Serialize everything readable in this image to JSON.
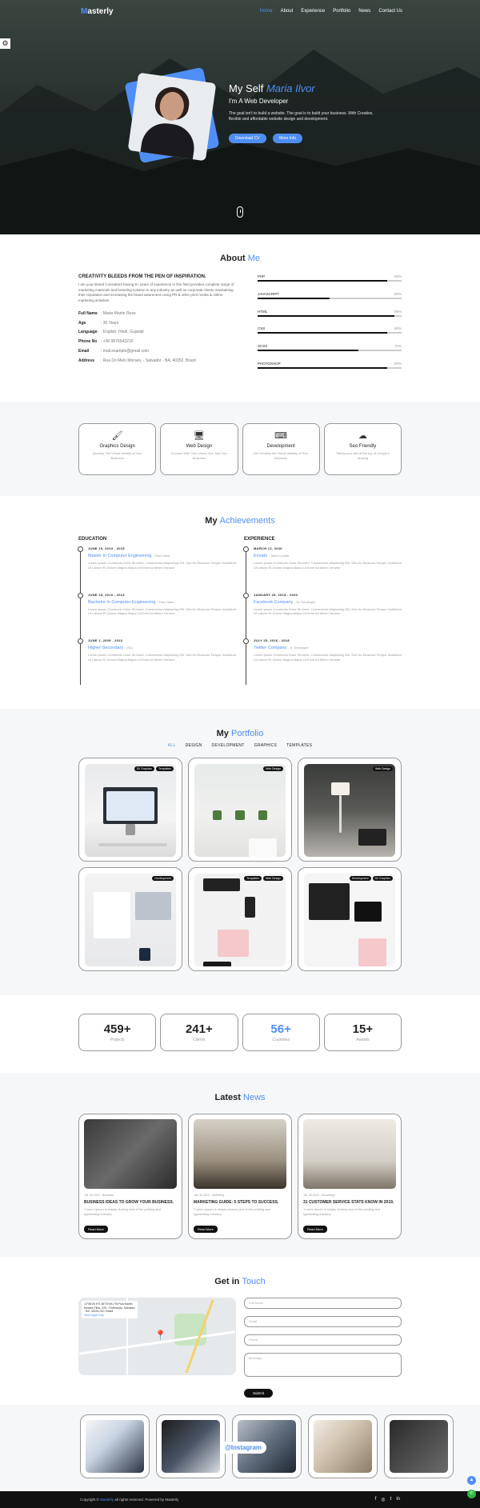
{
  "nav": {
    "logo_m": "M",
    "logo_rest": "asterly",
    "items": [
      "Home",
      "About",
      "Experience",
      "Portfolio",
      "News",
      "Contact Us"
    ]
  },
  "hero": {
    "title_prefix": "My Self",
    "title_name": "Maria Ilvor",
    "subtitle": "I'm A Web Developer",
    "desc": "The goal isn't to build a website. The goal is to build your business. With Creative, flexible and affordable website design and development.",
    "btn_cv": "Download CV",
    "btn_more": "More Info"
  },
  "about": {
    "title": "About",
    "title_accent": "Me",
    "heading": "CREATIVITY BLEEDS FROM THE PEN OF INSPIRATION.",
    "desc": "I am your Brand Consultant having 8+ years of experience in this field provides complete range of marketing materials and branding solution to any industry as well as corporate clients maintaining their reputation and increasing the brand awareness using PR & other print media & online marketing activities.",
    "info": [
      {
        "k": "Full Name",
        "v": ": Maria Martin Rose"
      },
      {
        "k": "Age",
        "v": ": 30 Years"
      },
      {
        "k": "Language",
        "v": ": English, Hindi, Gujarati"
      },
      {
        "k": "Phone No",
        "v": ": +00 9876543210"
      },
      {
        "k": "Email",
        "v": ": mail.example@gmail.com"
      },
      {
        "k": "Address",
        "v": ": Rua Do Melo Moraes, - Salvador - BA, 40352, Brazil"
      }
    ],
    "skills": [
      {
        "name": "PHP",
        "pct": "90%",
        "value": 0.9
      },
      {
        "name": "JAVASCRIPT",
        "pct": "50%",
        "value": 0.5
      },
      {
        "name": "HTML",
        "pct": "95%",
        "value": 0.95
      },
      {
        "name": "CSS",
        "pct": "90%",
        "value": 0.9
      },
      {
        "name": "SCSS",
        "pct": "70%",
        "value": 0.7
      },
      {
        "name": "PHOTOSHOP",
        "pct": "90%",
        "value": 0.9
      }
    ]
  },
  "services": [
    {
      "icon": "graphics-design-icon",
      "glyph": "🖌",
      "title": "Graphics Design",
      "desc": "Develop The Visual Identity of Your Business"
    },
    {
      "icon": "web-design-icon",
      "glyph": "🖥",
      "title": "Web Design",
      "desc": "Connect With Your Users, Not Just Your Business"
    },
    {
      "icon": "development-icon",
      "glyph": "⌨",
      "title": "Development",
      "desc": "We Develop the Visual Identity of Your Business"
    },
    {
      "icon": "seo-friendly-icon",
      "glyph": "☁",
      "title": "Seo Friendly",
      "desc": "Taking your site at the top of Google's ranking"
    }
  ],
  "achievements": {
    "title": "My",
    "title_accent": "Achievements",
    "education_label": "EDUCATION",
    "experience_label": "EXPERIENCE",
    "education": [
      {
        "date": "JUNE 15, 2013 - 2015",
        "title": "Master In Computer Engineering",
        "sub": "- First Class",
        "desc": "Lorem Ipsum Commodo Dolor Sit Amet, Consectetur Adipisicing Elit, Sed Do Eiusmod Tempor Incididunt Ut Labore Et Dolore Magna Aliqua Ut Enim Ad Minim Veniam"
      },
      {
        "date": "JUNE 15, 2010 - 2013",
        "title": "Bachelor In Computer Engineering",
        "sub": "- First Class",
        "desc": "Lorem Ipsum Commodo Dolor Sit Amet, Consectetur Adipisicing Elit, Sed Do Eiusmod Tempor Incididunt Ut Labore Et Dolore Magna Aliqua Ut Enim Ad Minim Veniam"
      },
      {
        "date": "JUNE 1, 2009 - 2010",
        "title": "Higher Secondary",
        "sub": "- (SC)",
        "desc": "Lorem Ipsum Commodo Dolor Sit Amet, Consectetur Adipisicing Elit, Sed Do Eiusmod Tempor Incididunt Ut Labore Et Dolore Magna Aliqua Ut Enim Ad Minim Veniam"
      }
    ],
    "experience": [
      {
        "date": "MARCH 12, 2020",
        "title": "Envato",
        "sub": "- Team Leader",
        "desc": "Lorem Ipsum Commodo Dolor Sit Amet, Consectetur Adipisicing Elit, Sed Do Eiusmod Tempor Incididunt Ut Labore Et Dolore Magna Aliqua Ut Enim Ad Minim Veniam"
      },
      {
        "date": "JANUARY 25, 2018 - 2020",
        "title": "Facebook Company",
        "sub": "- Sr. Developer",
        "desc": "Lorem Ipsum Commodo Dolor Sit Amet, Consectetur Adipisicing Elit, Sed Do Eiusmod Tempor Incididunt Ut Labore Et Dolore Magna Aliqua Ut Enim Ad Minim Veniam"
      },
      {
        "date": "JULY 25, 2016 - 2018",
        "title": "Twitter Company",
        "sub": "- Jr. Developer",
        "desc": "Lorem Ipsum Commodo Dolor Sit Amet, Consectetur Adipisicing Elit, Sed Do Eiusmod Tempor Incididunt Ut Labore Et Dolore Magna Aliqua Ut Enim Ad Minim Veniam"
      }
    ]
  },
  "portfolio": {
    "title": "My",
    "title_accent": "Portfolio",
    "filters": [
      "ALL",
      "DESIGN",
      "DEVELOPMENT",
      "GRAPHICS",
      "TEMPLATES"
    ],
    "items": [
      {
        "tags": [
          "3D Graphics",
          "Templates"
        ]
      },
      {
        "tags": [
          "Web Design"
        ]
      },
      {
        "tags": [
          "Web Design"
        ]
      },
      {
        "tags": [
          "Development"
        ]
      },
      {
        "tags": [
          "Templates",
          "Web Design"
        ]
      },
      {
        "tags": [
          "Development",
          "3D Graphics"
        ]
      }
    ]
  },
  "stats": [
    {
      "n": "459+",
      "l": "Projects"
    },
    {
      "n": "241+",
      "l": "Clients"
    },
    {
      "n": "56+",
      "l": "Countries"
    },
    {
      "n": "15+",
      "l": "Awards"
    }
  ],
  "news": {
    "title": "Latest",
    "title_accent": "News",
    "items": [
      {
        "meta": "JUL 30,2019 - Business",
        "title": "BUSINESS IDEAS TO GROW YOUR BUSINESS.",
        "desc": "\"Lorem Ipsum is simply dummy text of the printing and typesetting industry.",
        "btn": "Read More"
      },
      {
        "meta": "JUL 30,2019 - Marketing",
        "title": "MARKETING GUIDE: 5 STEPS TO SUCCESS.",
        "desc": "\"Lorem Ipsum is simply dummy text of the printing and typesetting industry.",
        "btn": "Read More"
      },
      {
        "meta": "JUL 30,2019 - Knowledge",
        "title": "31 CUSTOMER SERVICE STATS KNOW IN 2019.",
        "desc": "\"Lorem Ipsum is simply dummy text of the printing and typesetting industry.",
        "btn": "Read More"
      }
    ]
  },
  "contact": {
    "title": "Get in",
    "title_accent": "Touch",
    "map_address": "12°58'25.9\"S 38°29'49.1\"W Rua Martin Moraes Filho, 225 - Federação, Salvador - BA, 40231-010, Brazil",
    "map_link": "View larger map",
    "map_directions": "Directions",
    "placeholders": [
      "Full Name",
      "Email",
      "Phone",
      "Message"
    ],
    "submit": "Submit"
  },
  "instagram": {
    "label": "@Instagram"
  },
  "footer": {
    "copy_prefix": "Copyright ©",
    "brand": "Masterly",
    "copy_suffix": "all rights reserved. Powered by Masterly",
    "socials": [
      "f",
      "◎",
      "t",
      "in"
    ]
  },
  "colors": {
    "accent": "#4f8ef7",
    "whatsapp": "#2db742"
  }
}
